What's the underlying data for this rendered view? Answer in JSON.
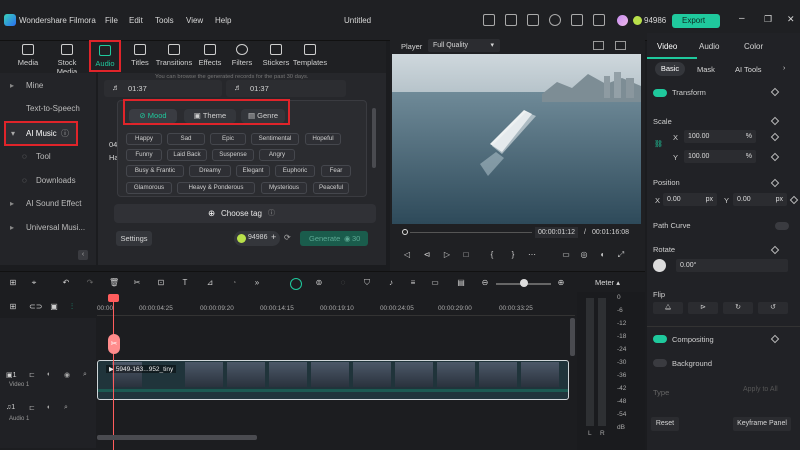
{
  "titlebar": {
    "app_name": "Wondershare Filmora",
    "menus": [
      "File",
      "Edit",
      "Tools",
      "View",
      "Help"
    ],
    "project_title": "Untitled",
    "coins": "94986",
    "export_label": "Export"
  },
  "media_tabs": [
    {
      "label": "Media",
      "icon": "media-icon"
    },
    {
      "label": "Stock Media",
      "icon": "stock-media-icon"
    },
    {
      "label": "Audio",
      "icon": "audio-icon"
    },
    {
      "label": "Titles",
      "icon": "titles-icon"
    },
    {
      "label": "Transitions",
      "icon": "transitions-icon"
    },
    {
      "label": "Effects",
      "icon": "effects-icon"
    },
    {
      "label": "Filters",
      "icon": "filters-icon"
    },
    {
      "label": "Stickers",
      "icon": "stickers-icon"
    },
    {
      "label": "Templates",
      "icon": "templates-icon"
    }
  ],
  "left_nav": {
    "items": [
      "Mine",
      "Text-to-Speech",
      "AI Music",
      "Tool",
      "Downloads",
      "AI Sound Effect",
      "Universal Musi..."
    ],
    "selected": "AI Music"
  },
  "music_panel": {
    "hint": "You can browse the generated records for the past 30 days.",
    "records": [
      {
        "time": "01:37"
      },
      {
        "time": "01:37"
      }
    ],
    "partial_left": [
      "04",
      "Ha"
    ],
    "tag_tabs": [
      "Mood",
      "Theme",
      "Genre"
    ],
    "active_tag_tab": "Mood",
    "moods": [
      "Happy",
      "Sad",
      "Epic",
      "Sentimental",
      "Hopeful",
      "Funny",
      "Laid Back",
      "Suspense",
      "Angry",
      "Busy & Frantic",
      "Dreamy",
      "Elegant",
      "Euphoric",
      "Fear",
      "Glamorous",
      "Heavy & Ponderous",
      "Mysterious",
      "Peaceful"
    ],
    "choose_tag_label": "Choose tag",
    "settings_label": "Settings",
    "coins": "94986",
    "generate_label": "Generate",
    "generate_cost": "30"
  },
  "player": {
    "label": "Player",
    "quality": "Full Quality",
    "current_time": "00:00:01:12",
    "separator": "/",
    "total_time": "00:01:16:08"
  },
  "properties": {
    "tabs": [
      "Video",
      "Audio",
      "Color"
    ],
    "subtabs": [
      "Basic",
      "Mask",
      "AI Tools"
    ],
    "transform_label": "Transform",
    "scale_label": "Scale",
    "scale_x_label": "X",
    "scale_x": "100.00",
    "scale_y_label": "Y",
    "scale_y": "100.00",
    "scale_unit": "%",
    "position_label": "Position",
    "pos_x_label": "X",
    "pos_x": "0.00",
    "pos_y_label": "Y",
    "pos_y": "0.00",
    "pos_unit": "px",
    "path_curve_label": "Path Curve",
    "rotate_label": "Rotate",
    "rotate_value": "0.00°",
    "flip_label": "Flip",
    "compositing_label": "Compositing",
    "background_label": "Background",
    "type_label": "Type",
    "apply_all_label": "Apply to All",
    "reset_label": "Reset",
    "keyframe_label": "Keyframe Panel"
  },
  "timeline": {
    "ruler": [
      "00:00",
      "00:00:04:25",
      "00:00:09:20",
      "00:00:14:15",
      "00:00:19:10",
      "00:00:24:05",
      "00:00:29:00",
      "00:00:33:25"
    ],
    "meter_label": "Meter",
    "meter_scale": [
      "0",
      "-6",
      "-12",
      "-18",
      "-24",
      "-30",
      "-36",
      "-42",
      "-48",
      "-54"
    ],
    "meter_unit": "dB",
    "meter_lr": [
      "L",
      "R"
    ],
    "video_track_label": "Video 1",
    "audio_track_label": "Audio 1",
    "video_track_num": "1",
    "audio_track_num": "1",
    "clip_name": "5949-163...952_tiny"
  },
  "colors": {
    "accent": "#1fc99d",
    "highlight_red": "#e0242a",
    "playhead": "#ff5d5d"
  }
}
